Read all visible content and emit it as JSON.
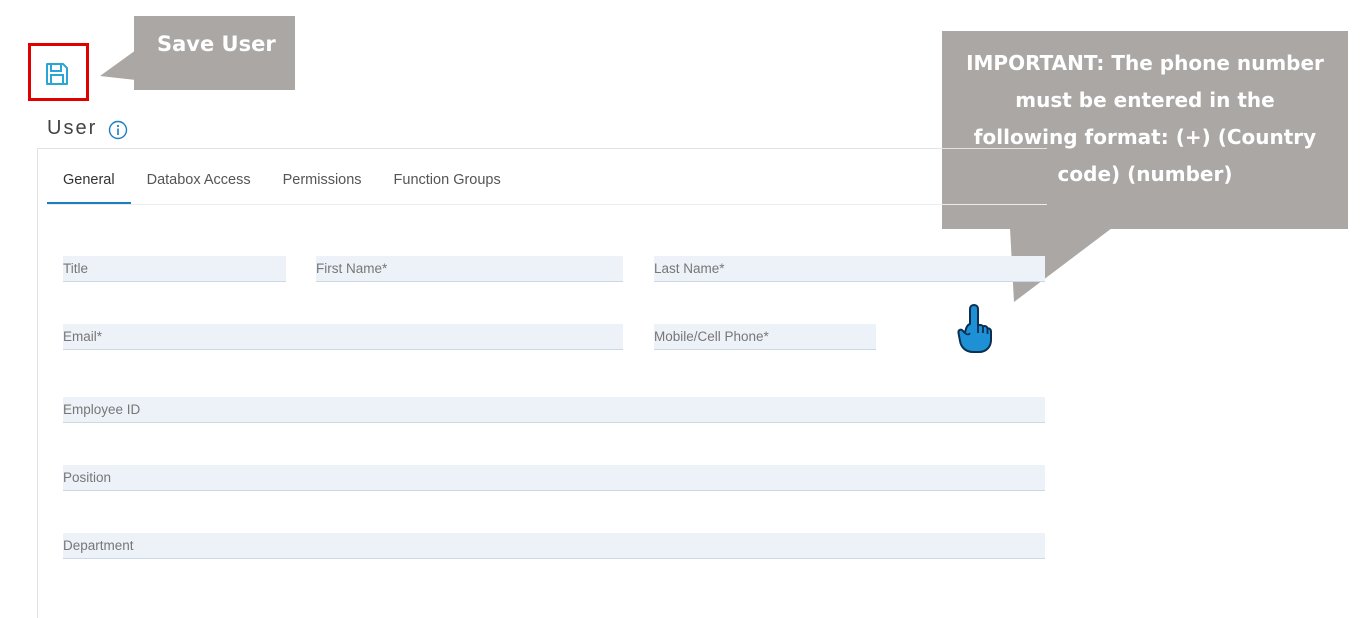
{
  "toolbar": {
    "save_icon": "floppy-disk-icon"
  },
  "callouts": {
    "save_user": "Save User",
    "phone_format": "IMPORTANT: The phone number must be entered in the following format: (+) (Country code) (number)"
  },
  "page": {
    "title": "User",
    "info_icon": "info-circle-icon"
  },
  "tabs": [
    {
      "label": "General",
      "active": true
    },
    {
      "label": "Databox Access",
      "active": false
    },
    {
      "label": "Permissions",
      "active": false
    },
    {
      "label": "Function Groups",
      "active": false
    }
  ],
  "form": {
    "title": {
      "placeholder": "Title",
      "value": ""
    },
    "first_name": {
      "placeholder": "First Name*",
      "value": ""
    },
    "last_name": {
      "placeholder": "Last Name*",
      "value": ""
    },
    "email": {
      "placeholder": "Email*",
      "value": ""
    },
    "mobile_phone": {
      "placeholder": "Mobile/Cell Phone*",
      "value": ""
    },
    "employee_id": {
      "placeholder": "Employee ID",
      "value": ""
    },
    "position": {
      "placeholder": "Position",
      "value": ""
    },
    "department": {
      "placeholder": "Department",
      "value": ""
    }
  },
  "pointer_icon": "pointing-hand-icon",
  "colors": {
    "accent": "#1a7fc1",
    "highlight": "#e00000",
    "callout_bg": "#aaa7a4",
    "field_bg": "#ecf2f8"
  }
}
